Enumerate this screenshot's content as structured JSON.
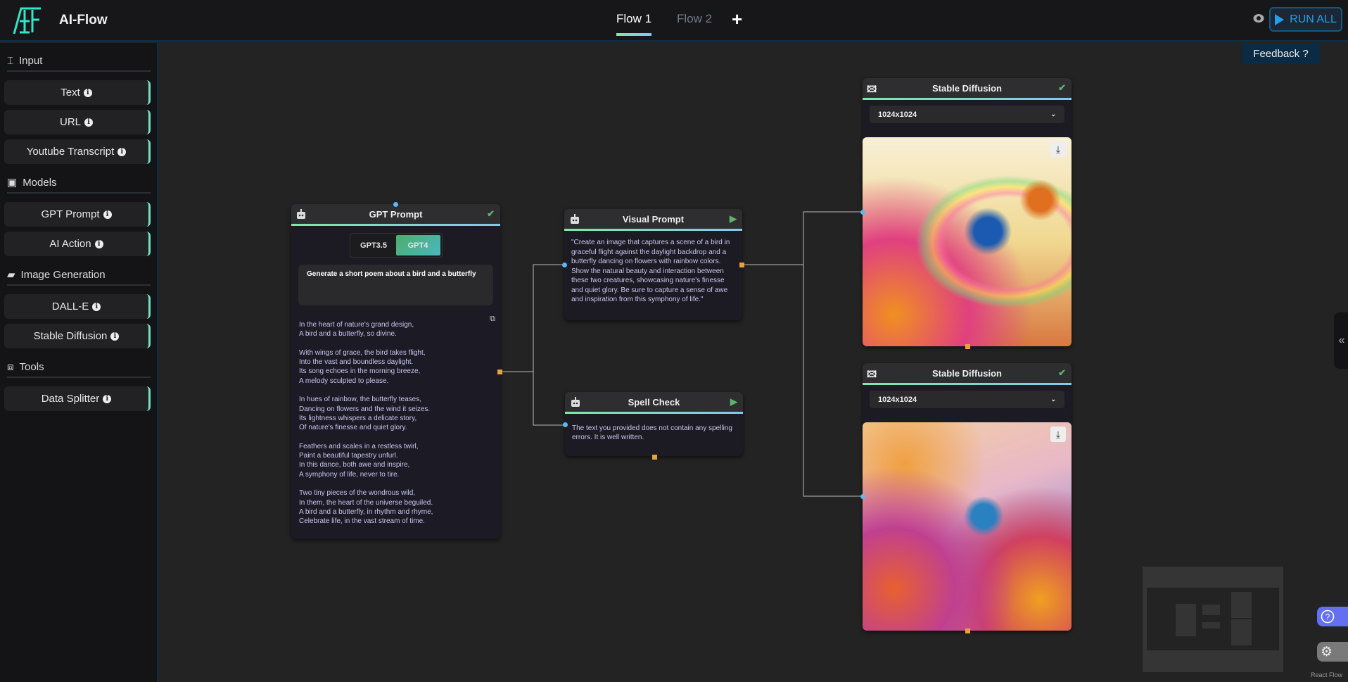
{
  "header": {
    "app_name": "AI-Flow",
    "tabs": [
      {
        "label": "Flow 1",
        "active": true
      },
      {
        "label": "Flow 2",
        "active": false
      }
    ],
    "add_tab": "+",
    "run_all": "RUN ALL",
    "feedback": "Feedback ?"
  },
  "sidebar": {
    "sections": [
      {
        "title": "Input",
        "icon": "text-cursor-icon",
        "items": [
          "Text",
          "URL",
          "Youtube Transcript"
        ]
      },
      {
        "title": "Models",
        "icon": "robot-icon",
        "items": [
          "GPT Prompt",
          "AI Action"
        ]
      },
      {
        "title": "Image Generation",
        "icon": "image-icon",
        "items": [
          "DALL-E",
          "Stable Diffusion"
        ]
      },
      {
        "title": "Tools",
        "icon": "toolbox-icon",
        "items": [
          "Data Splitter"
        ]
      }
    ]
  },
  "nodes": {
    "gpt": {
      "title": "GPT Prompt",
      "models": [
        "GPT3.5",
        "GPT4"
      ],
      "selected_model": "GPT4",
      "prompt": "Generate a short poem about a bird and a butterfly",
      "output": "In the heart of nature's grand design,\nA bird and a butterfly, so divine.\n\nWith wings of grace, the bird takes flight,\nInto the vast and boundless daylight.\nIts song echoes in the morning breeze,\nA melody sculpted to please.\n\nIn hues of rainbow, the butterfly teases,\nDancing on flowers and the wind it seizes.\nIts lightness whispers a delicate story,\nOf nature's finesse and quiet glory.\n\nFeathers and scales in a restless twirl,\nPaint a beautiful tapestry unfurl.\nIn this dance, both awe and inspire,\nA symphony of life, never to tire.\n\nTwo tiny pieces of the wondrous wild,\nIn them, the heart of the universe beguiled.\nA bird and a butterfly, in rhythm and rhyme,\nCelebrate life, in the vast stream of time."
    },
    "visual": {
      "title": "Visual Prompt",
      "output": "\"Create an image that captures a scene of a bird in graceful flight against the daylight backdrop and a butterfly dancing on flowers with rainbow colors. Show the natural beauty and interaction between these two creatures, showcasing nature's finesse and quiet glory. Be sure to capture a sense of awe and inspiration from this symphony of life.\""
    },
    "spell": {
      "title": "Spell Check",
      "output": "The text you provided does not contain any spelling errors. It is well written."
    },
    "sd1": {
      "title": "Stable Diffusion",
      "size": "1024x1024"
    },
    "sd2": {
      "title": "Stable Diffusion",
      "size": "1024x1024"
    }
  },
  "attribution": "React Flow",
  "colors": {
    "accent": "#6fe2c8",
    "run": "#20a0e8",
    "handle_in": "#5db8f0",
    "handle_out": "#e8a040",
    "help": "#6470f0"
  }
}
